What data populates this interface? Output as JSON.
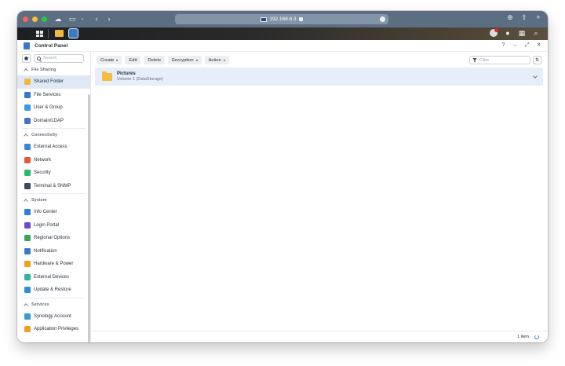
{
  "browser": {
    "url": "192.168.6.3"
  },
  "window": {
    "title": "Control Panel",
    "controls": [
      "?",
      "–",
      "⤢",
      "✕"
    ]
  },
  "sidebar": {
    "search_placeholder": "Search",
    "sections": [
      {
        "title": "File Sharing",
        "items": [
          {
            "label": "Shared Folder",
            "icon": "shared-folder-icon",
            "color": "#f3b73b",
            "active": true
          },
          {
            "label": "File Services",
            "icon": "file-services-icon",
            "color": "#3a78c9"
          },
          {
            "label": "User & Group",
            "icon": "user-group-icon",
            "color": "#3b9ae1"
          },
          {
            "label": "Domain/LDAP",
            "icon": "domain-ldap-icon",
            "color": "#4a6fc9"
          }
        ]
      },
      {
        "title": "Connectivity",
        "items": [
          {
            "label": "External Access",
            "icon": "external-access-icon",
            "color": "#3b86d8"
          },
          {
            "label": "Network",
            "icon": "network-icon",
            "color": "#e05a3a"
          },
          {
            "label": "Security",
            "icon": "security-icon",
            "color": "#2bb673"
          },
          {
            "label": "Terminal & SNMP",
            "icon": "terminal-icon",
            "color": "#3b4a5c"
          }
        ]
      },
      {
        "title": "System",
        "items": [
          {
            "label": "Info Center",
            "icon": "info-center-icon",
            "color": "#2f7fd6"
          },
          {
            "label": "Login Portal",
            "icon": "login-portal-icon",
            "color": "#6b4cc8"
          },
          {
            "label": "Regional Options",
            "icon": "regional-options-icon",
            "color": "#3aa655"
          },
          {
            "label": "Notification",
            "icon": "notification-icon",
            "color": "#3a78c9"
          },
          {
            "label": "Hardware & Power",
            "icon": "hardware-power-icon",
            "color": "#f0a020"
          },
          {
            "label": "External Devices",
            "icon": "external-devices-icon",
            "color": "#2bb5a0"
          },
          {
            "label": "Update & Restore",
            "icon": "update-restore-icon",
            "color": "#2f8fd6"
          }
        ]
      },
      {
        "title": "Services",
        "items": [
          {
            "label": "Synology Account",
            "icon": "synology-account-icon",
            "color": "#3a9ad8"
          },
          {
            "label": "Application Privileges",
            "icon": "app-privileges-icon",
            "color": "#f0a020"
          }
        ]
      }
    ]
  },
  "toolbar": {
    "create": "Create",
    "edit": "Edit",
    "delete": "Delete",
    "encryption": "Encryption",
    "action": "Action",
    "filter_placeholder": "Filter"
  },
  "folders": [
    {
      "name": "Pictures",
      "location": "Volume 1 (DataStorage)"
    }
  ],
  "footer": {
    "count": "1 item"
  }
}
